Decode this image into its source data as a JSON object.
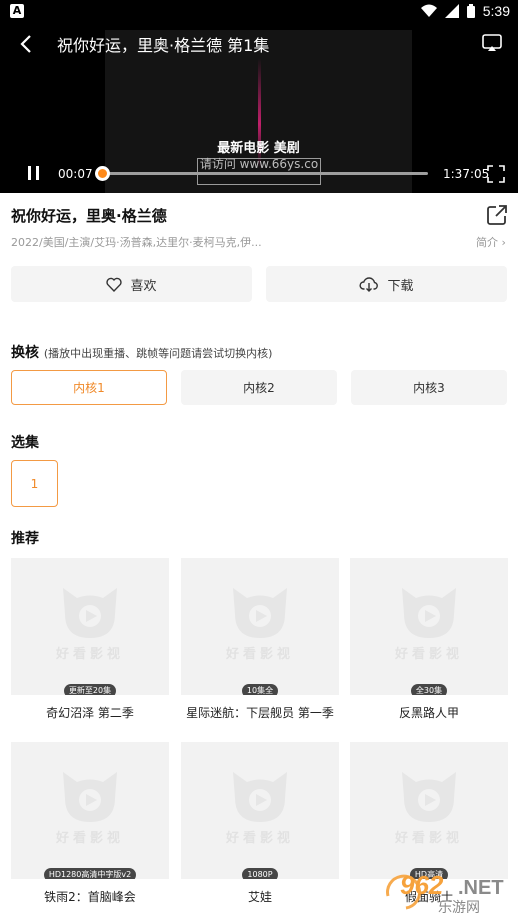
{
  "status": {
    "badge": "A",
    "time": "5:39"
  },
  "player": {
    "title": "祝你好运，里奥·格兰德 第1集",
    "watermark_title": "最新电影 美剧",
    "watermark_url": "请访问 www.66ys.co",
    "current_time": "00:07",
    "total_time": "1:37:05",
    "progress": 0.0012,
    "accent": "#ff7a00"
  },
  "info": {
    "title": "祝你好运，里奥·格兰德",
    "meta": "2022/美国/主演/艾玛·汤普森,达里尔·麦柯马克,伊...",
    "intro_label": "简介 ›"
  },
  "actions": {
    "like_label": "喜欢",
    "download_label": "下载"
  },
  "core": {
    "label": "换核",
    "hint": "(播放中出现重播、跳帧等问题请尝试切换内核)",
    "options": [
      "内核1",
      "内核2",
      "内核3"
    ],
    "selected": 0
  },
  "episodes": {
    "label": "选集",
    "items": [
      "1"
    ]
  },
  "recommend": {
    "label": "推荐",
    "brand": "好看影视",
    "items": [
      {
        "name": "奇幻沼泽 第二季",
        "badge": "更新至20集"
      },
      {
        "name": "星际迷航：下层舰员 第一季",
        "badge": "10集全"
      },
      {
        "name": "反黑路人甲",
        "badge": "全30集"
      },
      {
        "name": "铁雨2：首脑峰会",
        "badge": "HD1280高清中字版v2"
      },
      {
        "name": "艾娃",
        "badge": "1080P"
      },
      {
        "name": "假面骑士",
        "badge": "HD高清"
      }
    ]
  },
  "site_watermark": {
    "number": "962",
    "suffix": "NET",
    "sub": "乐游网"
  }
}
